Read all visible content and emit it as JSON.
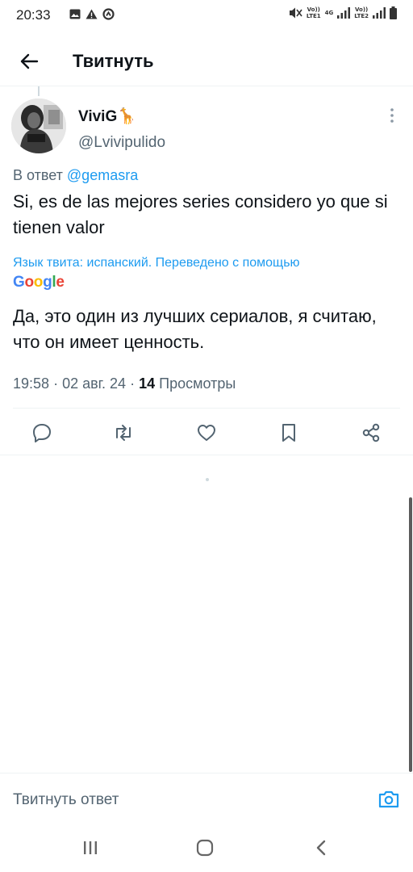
{
  "status_bar": {
    "time": "20:33",
    "icons_left": [
      "gallery-icon",
      "warning-icon",
      "data-saver-icon"
    ],
    "icons_right": [
      "mute-icon",
      "volte-icon",
      "signal-icon",
      "battery-icon"
    ],
    "sim1_label": "Vo))\nLTE1",
    "network_label": "4G",
    "sim2_label": "Vo))\nLTE2"
  },
  "header": {
    "title": "Твитнуть"
  },
  "tweet": {
    "display_name": "ViviG",
    "emoji": "🦒",
    "handle": "@Lvivipulido",
    "reply_prefix": "В ответ",
    "reply_to": "@gemasra",
    "text": "Si, es de las mejores series considero yo que si tienen valor",
    "translation_note": "Язык твита: испанский. Переведено с помощью",
    "translation_provider": "Google",
    "translated_text": "Да, это один из лучших сериалов, я считаю, что он имеет ценность.",
    "time": "19:58",
    "date": "02 авг. 24",
    "views_count": "14",
    "views_label": "Просмотры"
  },
  "actions": [
    "reply-icon",
    "retweet-icon",
    "like-icon",
    "bookmark-icon",
    "share-icon"
  ],
  "reply_bar": {
    "placeholder": "Твитнуть ответ"
  },
  "nav": [
    "recents-icon",
    "home-icon",
    "back-icon"
  ],
  "colors": {
    "accent": "#1d9bf0",
    "text": "#0f1419",
    "secondary": "#536471",
    "divider": "#eff3f4"
  }
}
